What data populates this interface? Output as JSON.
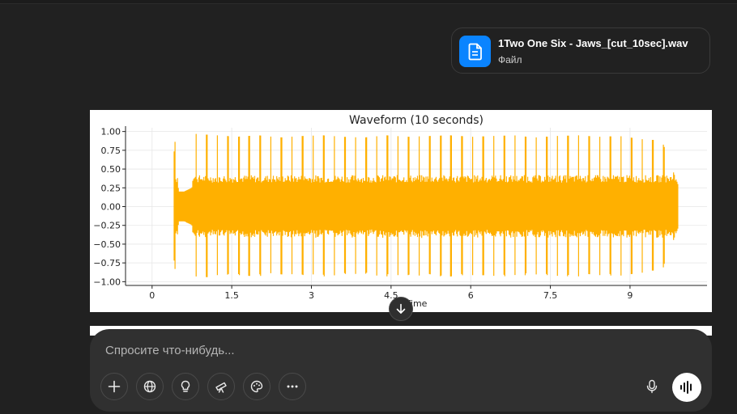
{
  "file": {
    "name": "1Two One Six - Jaws_[cut_10sec].wav",
    "type": "Файл",
    "icon": "document-icon",
    "icon_color": "#0a84ff"
  },
  "chart_data": {
    "type": "line",
    "title": "Waveform (10 seconds)",
    "xlabel": "Time",
    "ylabel": "",
    "xlim": [
      -0.5,
      10.45
    ],
    "ylim": [
      -1.05,
      1.05
    ],
    "x_ticks": [
      "0",
      "1.5",
      "3",
      "4.5",
      "6",
      "7.5",
      "9"
    ],
    "x_tick_values": [
      0,
      1.5,
      3,
      4.5,
      6,
      7.5,
      9
    ],
    "y_ticks": [
      "1.00",
      "0.75",
      "0.50",
      "0.25",
      "0.00",
      "−0.25",
      "−0.50",
      "−0.75",
      "−1.00"
    ],
    "y_tick_values": [
      1,
      0.75,
      0.5,
      0.25,
      0,
      -0.25,
      -0.5,
      -0.75,
      -1
    ],
    "grid": true,
    "color": "#ffb000",
    "series": [
      {
        "x": [
          0,
          0.4,
          0.42,
          0.5,
          0.6,
          0.75,
          0.8,
          1.2,
          1.6,
          2.0,
          2.4,
          2.8,
          3.2,
          3.6,
          4.0,
          4.4,
          4.8,
          5.2,
          5.6,
          6.0,
          6.4,
          6.8,
          7.2,
          7.6,
          8.0,
          8.4,
          8.8,
          9.2,
          9.6,
          9.9
        ],
        "y": [
          0,
          0,
          0.97,
          0.2,
          0.2,
          0.25,
          0.97,
          0.95,
          0.93,
          0.95,
          0.92,
          0.94,
          0.95,
          0.93,
          0.92,
          0.95,
          0.93,
          0.94,
          0.95,
          0.93,
          0.94,
          0.95,
          0.92,
          0.94,
          0.95,
          0.93,
          0.94,
          0.9,
          0.88,
          0.3
        ]
      }
    ]
  },
  "scroll_down_icon": "arrow-down-icon",
  "composer": {
    "placeholder": "Спросите что-нибудь...",
    "tools": [
      "plus-icon",
      "globe-icon",
      "lightbulb-icon",
      "telescope-icon",
      "palette-icon",
      "more-icon"
    ],
    "mic_icon": "microphone-icon",
    "voice_icon": "voice-wave-icon"
  }
}
